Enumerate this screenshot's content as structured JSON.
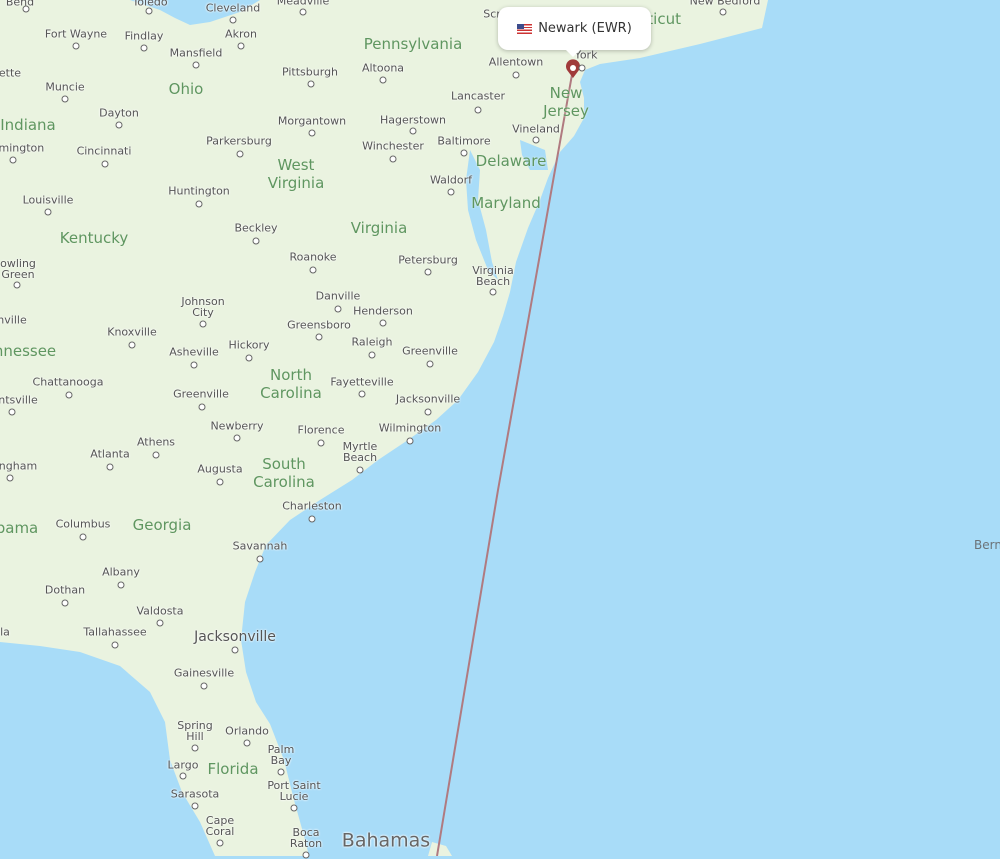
{
  "colors": {
    "water": "#a8dcf8",
    "land": "#eaf3e0",
    "route": "#b07a80",
    "marker": "#a03a3a"
  },
  "tooltip": {
    "flag_icon": "us-flag-icon",
    "label": "Newark (EWR)"
  },
  "states": [
    "Pennsylvania",
    "Ohio",
    "Indiana",
    "West\nVirginia",
    "Kentucky",
    "Virginia",
    "Maryland",
    "Delaware",
    "New\nJersey",
    "cticut",
    "nnessee",
    "North\nCarolina",
    "South\nCarolina",
    "Georgia",
    "bama",
    "Florida"
  ],
  "countries": [
    "Bahamas"
  ],
  "sea_labels": [
    "Bern"
  ],
  "cities": [
    "Bend",
    "Toledo",
    "Cleveland",
    "Meadville",
    "Fort Wayne",
    "Findlay",
    "Akron",
    "Mansfield",
    "Pittsburgh",
    "Altoona",
    "Allentown",
    "York",
    "Scr",
    "New Bedford",
    "ette",
    "Muncie",
    "Dayton",
    "Lancaster",
    "Hagerstown",
    "Morgantown",
    "Parkersburg",
    "Winchester",
    "Baltimore",
    "Vineland",
    "omington",
    "Cincinnati",
    "Waldorf",
    "Louisville",
    "Huntington",
    "Beckley",
    "Roanoke",
    "Petersburg",
    "Virginia\nBeach",
    "owling\nGreen",
    "Danville",
    "Johnson\nCity",
    "Henderson",
    "Greensboro",
    "nville",
    "Knoxville",
    "Raleigh",
    "Greenville",
    "Asheville",
    "Hickory",
    "Fayetteville",
    "Chattanooga",
    "ntsville",
    "Greenville",
    "Jacksonville",
    "Newberry",
    "Florence",
    "Wilmington",
    "Myrtle\nBeach",
    "Athens",
    "Atlanta",
    "ngham",
    "Augusta",
    "Charleston",
    "Columbus",
    "Savannah",
    "Albany",
    "Dothan",
    "Valdosta",
    "Tallahassee",
    "la",
    "Jacksonville",
    "Gainesville",
    "Spring\nHill",
    "Orlando",
    "Palm\nBay",
    "Largo",
    "Sarasota",
    "Port Saint\nLucie",
    "Cape\nCoral",
    "Boca\nRaton"
  ]
}
